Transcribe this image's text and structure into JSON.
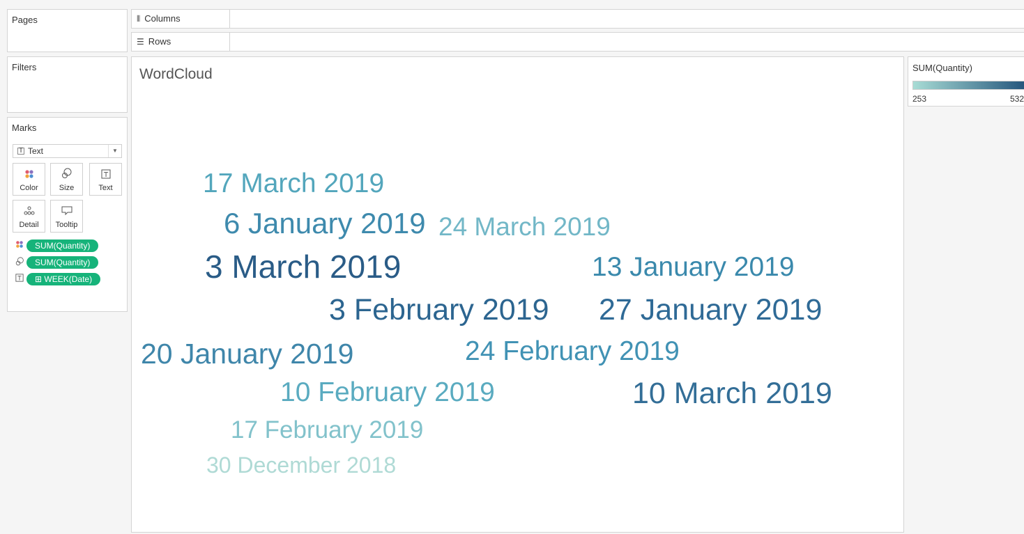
{
  "shelves": {
    "columns_label": "Columns",
    "rows_label": "Rows"
  },
  "cards": {
    "pages_title": "Pages",
    "filters_title": "Filters",
    "marks_title": "Marks"
  },
  "marks": {
    "mark_type": "Text",
    "buttons": {
      "color": "Color",
      "size": "Size",
      "text": "Text",
      "detail": "Detail",
      "tooltip": "Tooltip"
    },
    "pills": [
      {
        "icon": "color-icon",
        "label": "SUM(Quantity)"
      },
      {
        "icon": "size-icon",
        "label": "SUM(Quantity)"
      },
      {
        "icon": "text-icon",
        "label": "⊞ WEEK(Date)"
      }
    ]
  },
  "viz": {
    "title": "WordCloud"
  },
  "legend": {
    "title": "SUM(Quantity)",
    "min": "253",
    "max": "532",
    "color_low": "#a8dcd5",
    "color_high": "#1e4f78"
  },
  "words": [
    {
      "label": "17 March 2019",
      "color": "#53a6bc"
    },
    {
      "label": "6 January 2019",
      "color": "#3e8aad"
    },
    {
      "label": "24 March 2019",
      "color": "#72b7c7"
    },
    {
      "label": "3 March 2019",
      "color": "#2a5c87"
    },
    {
      "label": "13 January 2019",
      "color": "#3a89ac"
    },
    {
      "label": "3 February 2019",
      "color": "#2c6590"
    },
    {
      "label": "27 January 2019",
      "color": "#2f6a96"
    },
    {
      "label": "20 January 2019",
      "color": "#3f86aa"
    },
    {
      "label": "24 February 2019",
      "color": "#4192b4"
    },
    {
      "label": "10 February 2019",
      "color": "#5aabc0"
    },
    {
      "label": "10 March 2019",
      "color": "#336e97"
    },
    {
      "label": "17 February 2019",
      "color": "#82c2cb"
    },
    {
      "label": "30 December 2018",
      "color": "#afdad5"
    }
  ]
}
